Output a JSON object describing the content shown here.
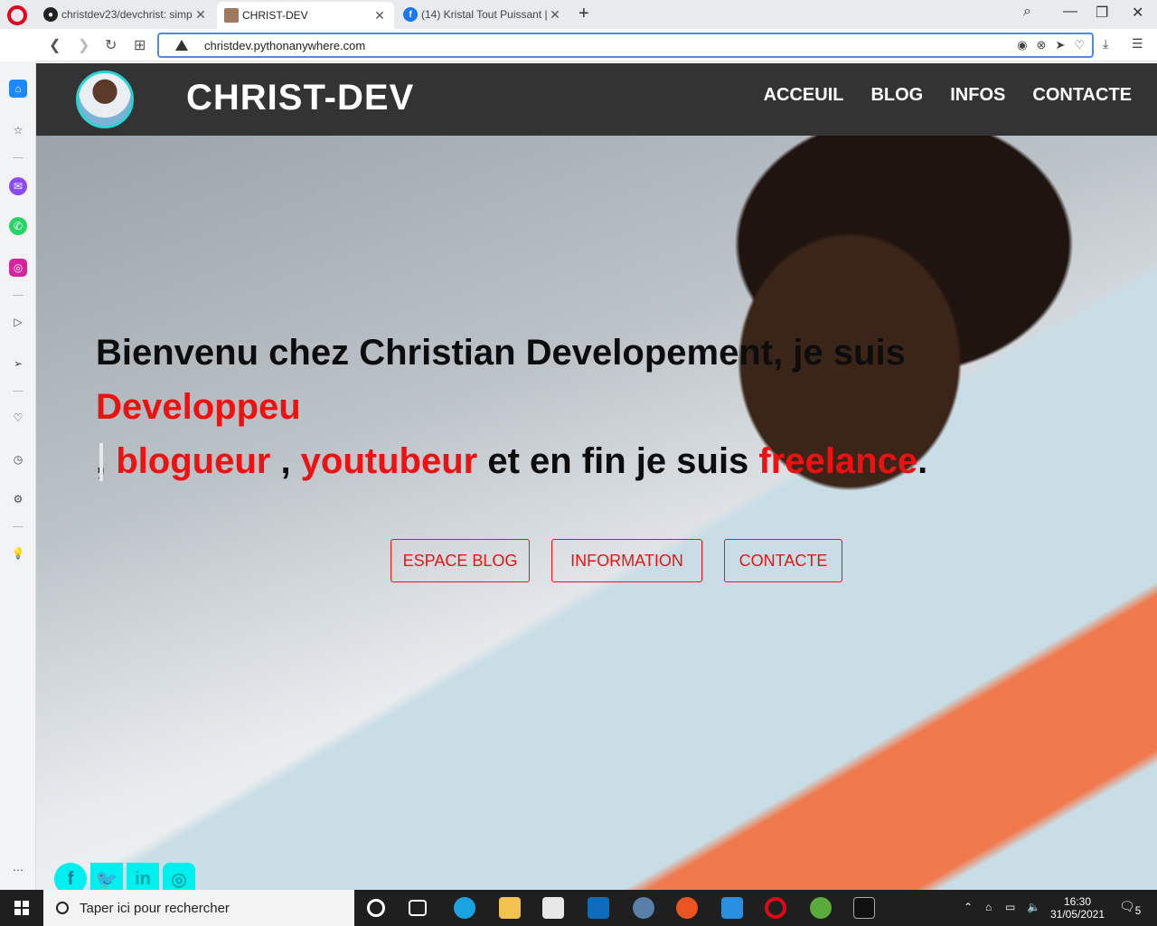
{
  "browser": {
    "tabs": [
      {
        "title": "christdev23/devchrist: simp",
        "icon": "github-icon",
        "active": false
      },
      {
        "title": "CHRIST-DEV",
        "icon": "site-avatar-icon",
        "active": true
      },
      {
        "title": "(14) Kristal Tout Puissant | F",
        "icon": "facebook-icon",
        "active": false
      }
    ],
    "url": "christdev.pythonanywhere.com"
  },
  "site": {
    "brand": "CHRIST-DEV",
    "menu": [
      "ACCEUIL",
      "BLOG",
      "INFOS",
      "CONTACTE"
    ],
    "hero": {
      "line_prefix": "Bienvenu chez Christian Developement, je suis ",
      "highlight_1": "Developpeu",
      "sep_1": ", ",
      "highlight_2": "blogueur",
      "sep_2": " , ",
      "highlight_3": "youtubeur",
      "mid": " et en fin je suis ",
      "highlight_4": "freelance",
      "end": "."
    },
    "buttons": [
      "ESPACE BLOG",
      "INFORMATION",
      "CONTACTE"
    ],
    "socials": [
      "facebook-icon",
      "twitter-icon",
      "linkedin-icon",
      "instagram-icon"
    ],
    "accent_color": "#f01010",
    "header_color": "#333333",
    "social_color": "#00f0f0"
  },
  "taskbar": {
    "search_placeholder": "Taper ici pour rechercher",
    "time": "16:30",
    "date": "31/05/2021",
    "notifications": "5"
  }
}
